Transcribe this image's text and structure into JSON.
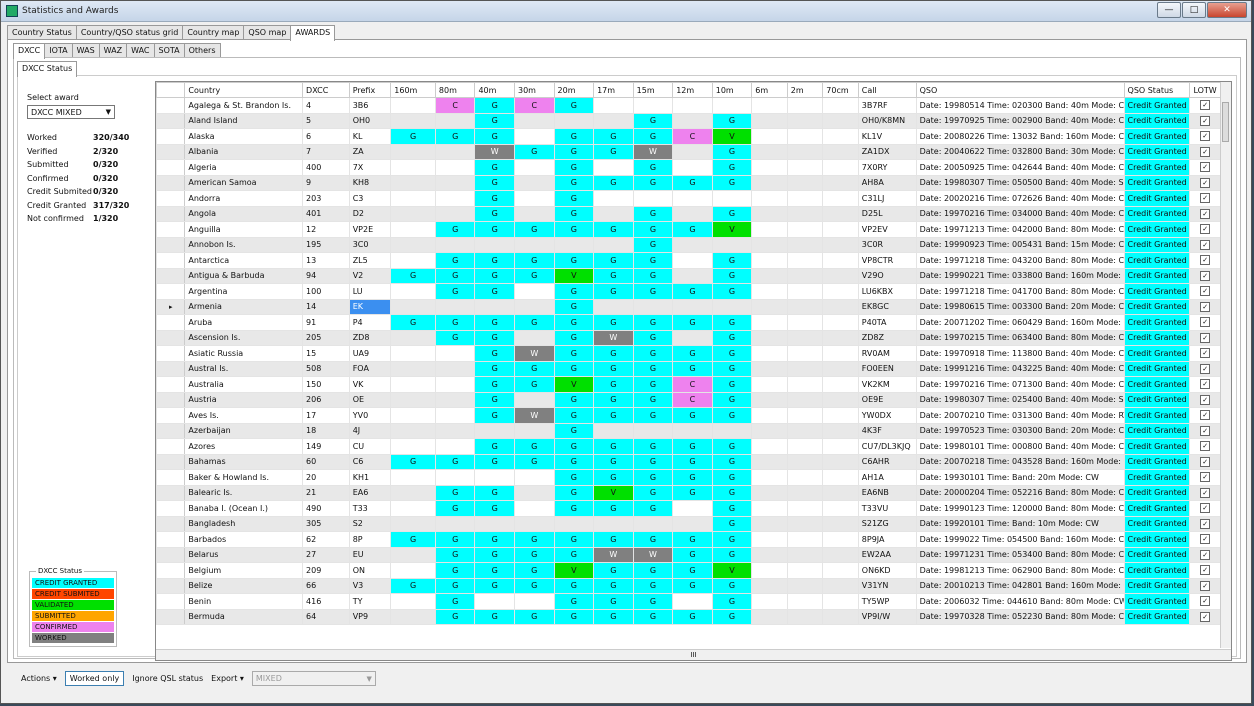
{
  "window": {
    "title": "Statistics and Awards",
    "min": "—",
    "max": "□",
    "close": "✕"
  },
  "tabs_top": [
    "Country Status",
    "Country/QSO status grid",
    "Country map",
    "QSO map",
    "AWARDS"
  ],
  "tabs_award": [
    "DXCC",
    "IOTA",
    "WAS",
    "WAZ",
    "WAC",
    "SOTA",
    "Others"
  ],
  "tabs_sub": [
    "DXCC Status"
  ],
  "left": {
    "select_label": "Select award",
    "select_value": "DXCC MIXED",
    "stats": [
      {
        "k": "Worked",
        "v": "320/340"
      },
      {
        "k": "Verified",
        "v": "2/320"
      },
      {
        "k": "Submitted",
        "v": "0/320"
      },
      {
        "k": "Confirmed",
        "v": "0/320"
      },
      {
        "k": "Credit Submited",
        "v": "0/320"
      },
      {
        "k": "Credit Granted",
        "v": "317/320"
      },
      {
        "k": "Not confirmed",
        "v": "1/320"
      }
    ]
  },
  "legend": {
    "title": "DXCC Status",
    "items": [
      {
        "label": "CREDIT GRANTED",
        "color": "#00ffff"
      },
      {
        "label": "CREDIT SUBMITED",
        "color": "#ff4500"
      },
      {
        "label": "VALIDATED",
        "color": "#00e000"
      },
      {
        "label": "SUBMITTED",
        "color": "#ffa500"
      },
      {
        "label": "CONFIRMED",
        "color": "#ee82ee"
      },
      {
        "label": "WORKED",
        "color": "#808080"
      }
    ]
  },
  "grid": {
    "headers": [
      "Country",
      "DXCC",
      "Prefix",
      "160m",
      "80m",
      "40m",
      "30m",
      "20m",
      "17m",
      "15m",
      "12m",
      "10m",
      "6m",
      "2m",
      "70cm",
      "Call",
      "QSO",
      "QSO Status",
      "LOTW"
    ],
    "rows": [
      {
        "country": "Agalega & St. Brandon Is.",
        "dxcc": "4",
        "prefix": "3B6",
        "bands": "_CGCG______",
        "call": "3B7RF",
        "qso": "Date: 19980514 Time: 020300 Band: 40m Mode: CW",
        "status": "Credit Granted"
      },
      {
        "country": "Aland Island",
        "dxcc": "5",
        "prefix": "OH0",
        "bands": "__G___G_G__",
        "call": "OH0/K8MN",
        "qso": "Date: 19970925 Time: 002900 Band: 40m Mode: CW",
        "status": "Credit Granted"
      },
      {
        "country": "Alaska",
        "dxcc": "6",
        "prefix": "KL",
        "bands": "GGG_GGGCV__",
        "call": "KL1V",
        "qso": "Date: 20080226 Time: 13032 Band: 160m Mode: CW",
        "status": "Credit Granted"
      },
      {
        "country": "Albania",
        "dxcc": "7",
        "prefix": "ZA",
        "bands": "__WGGGW_G__",
        "call": "ZA1DX",
        "qso": "Date: 20040622 Time: 032800 Band: 30m Mode: CW",
        "status": "Credit Granted"
      },
      {
        "country": "Algeria",
        "dxcc": "400",
        "prefix": "7X",
        "bands": "__G_G_G_G__",
        "call": "7X0RY",
        "qso": "Date: 20050925 Time: 042644 Band: 40m Mode: CW",
        "status": "Credit Granted"
      },
      {
        "country": "American Samoa",
        "dxcc": "9",
        "prefix": "KH8",
        "bands": "__G_GGGGG__",
        "call": "AH8A",
        "qso": "Date: 19980307 Time: 050500 Band: 40m Mode: SSB",
        "status": "Credit Granted"
      },
      {
        "country": "Andorra",
        "dxcc": "203",
        "prefix": "C3",
        "bands": "__G_G______",
        "call": "C31LJ",
        "qso": "Date: 20020216 Time: 072626 Band: 40m Mode: CW",
        "status": "Credit Granted"
      },
      {
        "country": "Angola",
        "dxcc": "401",
        "prefix": "D2",
        "bands": "__G_G_G_G__",
        "call": "D25L",
        "qso": "Date: 19970216 Time: 034000 Band: 40m Mode: CW",
        "status": "Credit Granted"
      },
      {
        "country": "Anguilla",
        "dxcc": "12",
        "prefix": "VP2E",
        "bands": "_GGGGGGGV__",
        "call": "VP2EV",
        "qso": "Date: 19971213 Time: 042000 Band: 80m Mode: CW",
        "status": "Credit Granted"
      },
      {
        "country": "Annobon Is.",
        "dxcc": "195",
        "prefix": "3C0",
        "bands": "______G____",
        "call": "3C0R",
        "qso": "Date: 19990923 Time: 005431 Band: 15m Mode: CW",
        "status": "Credit Granted"
      },
      {
        "country": "Antarctica",
        "dxcc": "13",
        "prefix": "ZL5",
        "bands": "_GGGGGG_G__",
        "call": "VP8CTR",
        "qso": "Date: 19971218 Time: 043200 Band: 80m Mode: CW",
        "status": "Credit Granted"
      },
      {
        "country": "Antigua & Barbuda",
        "dxcc": "94",
        "prefix": "V2",
        "bands": "GGGGVGG_G__",
        "call": "V29O",
        "qso": "Date: 19990221 Time: 033800 Band: 160m Mode: CW",
        "status": "Credit Granted"
      },
      {
        "country": "Argentina",
        "dxcc": "100",
        "prefix": "LU",
        "bands": "_GG_GGGGG__",
        "call": "LU6KBX",
        "qso": "Date: 19971218 Time: 041700 Band: 80m Mode: CW",
        "status": "Credit Granted"
      },
      {
        "country": "Armenia",
        "dxcc": "14",
        "prefix": "EK",
        "bands": "____G______",
        "call": "EK8GC",
        "qso": "Date: 19980615 Time: 003300 Band: 20m Mode: CW",
        "status": "Credit Granted"
      },
      {
        "country": "Aruba",
        "dxcc": "91",
        "prefix": "P4",
        "bands": "GGGGGGGGG__",
        "call": "P40TA",
        "qso": "Date: 20071202 Time: 060429 Band: 160m Mode: CW",
        "status": "Credit Granted"
      },
      {
        "country": "Ascension Is.",
        "dxcc": "205",
        "prefix": "ZD8",
        "bands": "_GG_GWG_G__",
        "call": "ZD8Z",
        "qso": "Date: 19970215 Time: 063400 Band: 80m Mode: CW",
        "status": "Credit Granted"
      },
      {
        "country": "Asiatic Russia",
        "dxcc": "15",
        "prefix": "UA9",
        "bands": "__GWGGGGG__",
        "call": "RV0AM",
        "qso": "Date: 19970918 Time: 113800 Band: 40m Mode: CW",
        "status": "Credit Granted"
      },
      {
        "country": "Austral Is.",
        "dxcc": "508",
        "prefix": "FOA",
        "bands": "__GGGGGGG__",
        "call": "FO0EEN",
        "qso": "Date: 19991216 Time: 043225 Band: 40m Mode: CW",
        "status": "Credit Granted"
      },
      {
        "country": "Australia",
        "dxcc": "150",
        "prefix": "VK",
        "bands": "__GGVGGCG__",
        "call": "VK2KM",
        "qso": "Date: 19970216 Time: 071300 Band: 40m Mode: CW",
        "status": "Credit Granted"
      },
      {
        "country": "Austria",
        "dxcc": "206",
        "prefix": "OE",
        "bands": "__G_GGGCG__",
        "call": "OE9E",
        "qso": "Date: 19980307 Time: 025400 Band: 40m Mode: SSB",
        "status": "Credit Granted"
      },
      {
        "country": "Aves Is.",
        "dxcc": "17",
        "prefix": "YV0",
        "bands": "__GWGGGGG__",
        "call": "YW0DX",
        "qso": "Date: 20070210 Time: 031300 Band: 40m Mode: RTTY",
        "status": "Credit Granted"
      },
      {
        "country": "Azerbaijan",
        "dxcc": "18",
        "prefix": "4J",
        "bands": "____G______",
        "call": "4K3F",
        "qso": "Date: 19970523 Time: 030300 Band: 20m Mode: CW",
        "status": "Credit Granted"
      },
      {
        "country": "Azores",
        "dxcc": "149",
        "prefix": "CU",
        "bands": "__GGGGGGG__",
        "call": "CU7/DL3KJQ",
        "qso": "Date: 19980101 Time: 000800 Band: 40m Mode: CW",
        "status": "Credit Granted"
      },
      {
        "country": "Bahamas",
        "dxcc": "60",
        "prefix": "C6",
        "bands": "GGGGGGGGG__",
        "call": "C6AHR",
        "qso": "Date: 20070218 Time: 043528 Band: 160m Mode: CW",
        "status": "Credit Granted"
      },
      {
        "country": "Baker & Howland Is.",
        "dxcc": "20",
        "prefix": "KH1",
        "bands": "____GGGGG__",
        "call": "AH1A",
        "qso": "Date: 19930101 Time: Band: 20m Mode: CW",
        "status": "Credit Granted"
      },
      {
        "country": "Balearic Is.",
        "dxcc": "21",
        "prefix": "EA6",
        "bands": "_GG_GVGGG__",
        "call": "EA6NB",
        "qso": "Date: 20000204 Time: 052216 Band: 80m Mode: CW",
        "status": "Credit Granted"
      },
      {
        "country": "Banaba I. (Ocean I.)",
        "dxcc": "490",
        "prefix": "T33",
        "bands": "_GG_GGG_G__",
        "call": "T33VU",
        "qso": "Date: 19990123 Time: 120000 Band: 80m Mode: CW",
        "status": "Credit Granted"
      },
      {
        "country": "Bangladesh",
        "dxcc": "305",
        "prefix": "S2",
        "bands": "________G__",
        "call": "S21ZG",
        "qso": "Date: 19920101 Time: Band: 10m Mode: CW",
        "status": "Credit Granted"
      },
      {
        "country": "Barbados",
        "dxcc": "62",
        "prefix": "8P",
        "bands": "GGGGGGGGG__",
        "call": "8P9JA",
        "qso": "Date: 1999022 Time: 054500 Band: 160m Mode: CW",
        "status": "Credit Granted"
      },
      {
        "country": "Belarus",
        "dxcc": "27",
        "prefix": "EU",
        "bands": "_GGGGWWGG__",
        "call": "EW2AA",
        "qso": "Date: 19971231 Time: 053400 Band: 80m Mode: CW",
        "status": "Credit Granted"
      },
      {
        "country": "Belgium",
        "dxcc": "209",
        "prefix": "ON",
        "bands": "_GGGVGGGV__",
        "call": "ON6KD",
        "qso": "Date: 19981213 Time: 062900 Band: 80m Mode: CW",
        "status": "Credit Granted"
      },
      {
        "country": "Belize",
        "dxcc": "66",
        "prefix": "V3",
        "bands": "GGGGGGGGG__",
        "call": "V31YN",
        "qso": "Date: 20010213 Time: 042801 Band: 160m Mode: CW",
        "status": "Credit Granted"
      },
      {
        "country": "Benin",
        "dxcc": "416",
        "prefix": "TY",
        "bands": "_G__GGG_G__",
        "call": "TY5WP",
        "qso": "Date: 2006032 Time: 044610 Band: 80m Mode: CW",
        "status": "Credit Granted"
      },
      {
        "country": "Bermuda",
        "dxcc": "64",
        "prefix": "VP9",
        "bands": "_GGGGGGGG__",
        "call": "VP9I/W",
        "qso": "Date: 19970328 Time: 052230 Band: 80m Mode: CW",
        "status": "Credit Granted"
      }
    ],
    "hscroll_label": "III"
  },
  "bottom": {
    "actions": "Actions ▾",
    "worked_only": "Worked only",
    "ignore": "Ignore QSL status",
    "export": "Export ▾",
    "mode": "MIXED"
  }
}
